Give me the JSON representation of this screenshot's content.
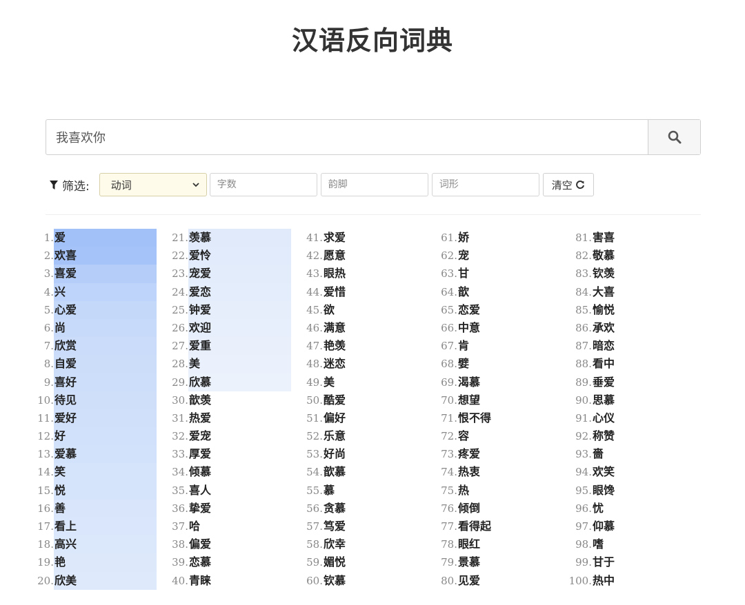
{
  "title": "汉语反向词典",
  "search": {
    "value": "我喜欢你",
    "icon": "search-icon"
  },
  "filters": {
    "label": "筛选:",
    "pos_value": "动词",
    "char_count_placeholder": "字数",
    "rhyme_placeholder": "韵脚",
    "form_placeholder": "词形",
    "clear_label": "清空"
  },
  "colors": {
    "highlight": "#a2c1f8",
    "highlight_fade": "#eef3fc",
    "select_bg": "#fffbea"
  },
  "results": [
    {
      "n": "1.",
      "w": "爱",
      "s": 1.0
    },
    {
      "n": "2.",
      "w": "欢喜",
      "s": 0.96
    },
    {
      "n": "3.",
      "w": "喜爱",
      "s": 0.76
    },
    {
      "n": "4.",
      "w": "兴",
      "s": 0.62
    },
    {
      "n": "5.",
      "w": "心爱",
      "s": 0.55
    },
    {
      "n": "6.",
      "w": "尚",
      "s": 0.5
    },
    {
      "n": "7.",
      "w": "欣赏",
      "s": 0.47
    },
    {
      "n": "8.",
      "w": "自爱",
      "s": 0.45
    },
    {
      "n": "9.",
      "w": "喜好",
      "s": 0.43
    },
    {
      "n": "10.",
      "w": "待见",
      "s": 0.41
    },
    {
      "n": "11.",
      "w": "爱好",
      "s": 0.39
    },
    {
      "n": "12.",
      "w": "好",
      "s": 0.37
    },
    {
      "n": "13.",
      "w": "爱慕",
      "s": 0.35
    },
    {
      "n": "14.",
      "w": "笑",
      "s": 0.33
    },
    {
      "n": "15.",
      "w": "悦",
      "s": 0.31
    },
    {
      "n": "16.",
      "w": "善",
      "s": 0.29
    },
    {
      "n": "17.",
      "w": "看上",
      "s": 0.27
    },
    {
      "n": "18.",
      "w": "高兴",
      "s": 0.25
    },
    {
      "n": "19.",
      "w": "艳",
      "s": 0.23
    },
    {
      "n": "20.",
      "w": "欣美",
      "s": 0.21
    },
    {
      "n": "21.",
      "w": "羡慕",
      "s": 0.19
    },
    {
      "n": "22.",
      "w": "爱怜",
      "s": 0.17
    },
    {
      "n": "23.",
      "w": "宠爱",
      "s": 0.15
    },
    {
      "n": "24.",
      "w": "爱恋",
      "s": 0.13
    },
    {
      "n": "25.",
      "w": "钟爱",
      "s": 0.11
    },
    {
      "n": "26.",
      "w": "欢迎",
      "s": 0.09
    },
    {
      "n": "27.",
      "w": "爱重",
      "s": 0.07
    },
    {
      "n": "28.",
      "w": "美",
      "s": 0.05
    },
    {
      "n": "29.",
      "w": "欣慕",
      "s": 0.03
    },
    {
      "n": "30.",
      "w": "歆羡",
      "s": 0
    },
    {
      "n": "31.",
      "w": "热爱",
      "s": 0
    },
    {
      "n": "32.",
      "w": "爱宠",
      "s": 0
    },
    {
      "n": "33.",
      "w": "厚爱",
      "s": 0
    },
    {
      "n": "34.",
      "w": "倾慕",
      "s": 0
    },
    {
      "n": "35.",
      "w": "喜人",
      "s": 0
    },
    {
      "n": "36.",
      "w": "挚爱",
      "s": 0
    },
    {
      "n": "37.",
      "w": "哈",
      "s": 0
    },
    {
      "n": "38.",
      "w": "偏爱",
      "s": 0
    },
    {
      "n": "39.",
      "w": "恋慕",
      "s": 0
    },
    {
      "n": "40.",
      "w": "青睐",
      "s": 0
    },
    {
      "n": "41.",
      "w": "求爱",
      "s": 0
    },
    {
      "n": "42.",
      "w": "愿意",
      "s": 0
    },
    {
      "n": "43.",
      "w": "眼热",
      "s": 0
    },
    {
      "n": "44.",
      "w": "爱惜",
      "s": 0
    },
    {
      "n": "45.",
      "w": "欲",
      "s": 0
    },
    {
      "n": "46.",
      "w": "满意",
      "s": 0
    },
    {
      "n": "47.",
      "w": "艳羡",
      "s": 0
    },
    {
      "n": "48.",
      "w": "迷恋",
      "s": 0
    },
    {
      "n": "49.",
      "w": "美",
      "s": 0
    },
    {
      "n": "50.",
      "w": "酷爱",
      "s": 0
    },
    {
      "n": "51.",
      "w": "偏好",
      "s": 0
    },
    {
      "n": "52.",
      "w": "乐意",
      "s": 0
    },
    {
      "n": "53.",
      "w": "好尚",
      "s": 0
    },
    {
      "n": "54.",
      "w": "歆慕",
      "s": 0
    },
    {
      "n": "55.",
      "w": "慕",
      "s": 0
    },
    {
      "n": "56.",
      "w": "贪慕",
      "s": 0
    },
    {
      "n": "57.",
      "w": "笃爱",
      "s": 0
    },
    {
      "n": "58.",
      "w": "欣幸",
      "s": 0
    },
    {
      "n": "59.",
      "w": "媚悦",
      "s": 0
    },
    {
      "n": "60.",
      "w": "钦慕",
      "s": 0
    },
    {
      "n": "61.",
      "w": "娇",
      "s": 0
    },
    {
      "n": "62.",
      "w": "宠",
      "s": 0
    },
    {
      "n": "63.",
      "w": "甘",
      "s": 0
    },
    {
      "n": "64.",
      "w": "歆",
      "s": 0
    },
    {
      "n": "65.",
      "w": "恋爱",
      "s": 0
    },
    {
      "n": "66.",
      "w": "中意",
      "s": 0
    },
    {
      "n": "67.",
      "w": "肯",
      "s": 0
    },
    {
      "n": "68.",
      "w": "嬖",
      "s": 0
    },
    {
      "n": "69.",
      "w": "渴慕",
      "s": 0
    },
    {
      "n": "70.",
      "w": "想望",
      "s": 0
    },
    {
      "n": "71.",
      "w": "恨不得",
      "s": 0
    },
    {
      "n": "72.",
      "w": "容",
      "s": 0
    },
    {
      "n": "73.",
      "w": "疼爱",
      "s": 0
    },
    {
      "n": "74.",
      "w": "热衷",
      "s": 0
    },
    {
      "n": "75.",
      "w": "热",
      "s": 0
    },
    {
      "n": "76.",
      "w": "倾倒",
      "s": 0
    },
    {
      "n": "77.",
      "w": "看得起",
      "s": 0
    },
    {
      "n": "78.",
      "w": "眼红",
      "s": 0
    },
    {
      "n": "79.",
      "w": "景慕",
      "s": 0
    },
    {
      "n": "80.",
      "w": "见爱",
      "s": 0
    },
    {
      "n": "81.",
      "w": "害喜",
      "s": 0
    },
    {
      "n": "82.",
      "w": "敬慕",
      "s": 0
    },
    {
      "n": "83.",
      "w": "钦羡",
      "s": 0
    },
    {
      "n": "84.",
      "w": "大喜",
      "s": 0
    },
    {
      "n": "85.",
      "w": "愉悦",
      "s": 0
    },
    {
      "n": "86.",
      "w": "承欢",
      "s": 0
    },
    {
      "n": "87.",
      "w": "暗恋",
      "s": 0
    },
    {
      "n": "88.",
      "w": "看中",
      "s": 0
    },
    {
      "n": "89.",
      "w": "垂爱",
      "s": 0
    },
    {
      "n": "90.",
      "w": "思慕",
      "s": 0
    },
    {
      "n": "91.",
      "w": "心仪",
      "s": 0
    },
    {
      "n": "92.",
      "w": "称赞",
      "s": 0
    },
    {
      "n": "93.",
      "w": "嗇",
      "s": 0
    },
    {
      "n": "94.",
      "w": "欢笑",
      "s": 0
    },
    {
      "n": "95.",
      "w": "眼馋",
      "s": 0
    },
    {
      "n": "96.",
      "w": "忧",
      "s": 0
    },
    {
      "n": "97.",
      "w": "仰慕",
      "s": 0
    },
    {
      "n": "98.",
      "w": "嗜",
      "s": 0
    },
    {
      "n": "99.",
      "w": "甘于",
      "s": 0
    },
    {
      "n": "100.",
      "w": "热中",
      "s": 0
    }
  ]
}
